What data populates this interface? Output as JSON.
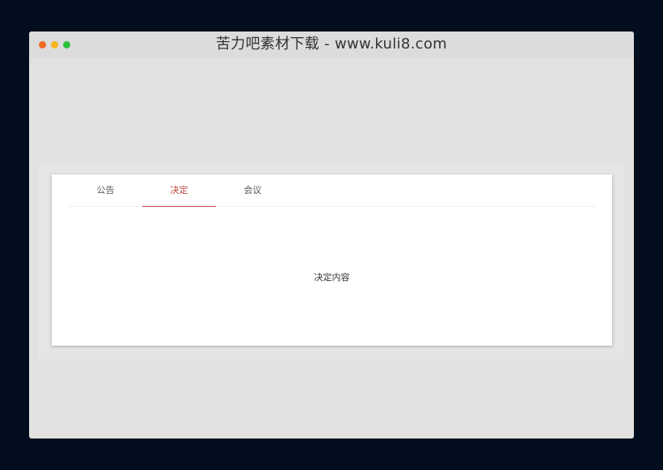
{
  "window": {
    "title": "苦力吧素材下载 - www.kuli8.com",
    "controls": [
      {
        "name": "close",
        "color": "#f26a21"
      },
      {
        "name": "minimize",
        "color": "#f5b51c"
      },
      {
        "name": "maximize",
        "color": "#2bc13e"
      }
    ]
  },
  "tabs": {
    "items": [
      {
        "label": "公告",
        "active": false
      },
      {
        "label": "决定",
        "active": true
      },
      {
        "label": "会议",
        "active": false
      }
    ],
    "active_color": "#c0463c"
  },
  "panel": {
    "content": "决定内容"
  }
}
